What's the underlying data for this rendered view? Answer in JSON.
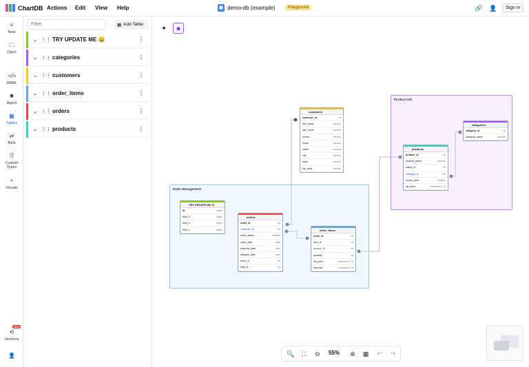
{
  "app": {
    "name": "ChartDB"
  },
  "menu": [
    "Actions",
    "Edit",
    "View",
    "Help"
  ],
  "database": {
    "name": "demo-db (example)",
    "badge": "Playground"
  },
  "header_right": {
    "signin": "Sign in"
  },
  "rail": {
    "items": [
      {
        "label": "New",
        "icon": "plus-icon"
      },
      {
        "label": "Open",
        "icon": "folder-icon"
      },
      {
        "label": "DBML",
        "icon": "code-icon"
      },
      {
        "label": "Agent",
        "icon": "agent-icon"
      },
      {
        "label": "Tables",
        "icon": "table-icon",
        "active": true
      },
      {
        "label": "Refs",
        "icon": "refs-icon"
      },
      {
        "label": "Custom Types",
        "icon": "file-icon"
      },
      {
        "label": "Visuals",
        "icon": "visuals-icon"
      }
    ],
    "bottom": [
      {
        "label": "Versions",
        "icon": "history-icon",
        "tag": "New"
      },
      {
        "label": "",
        "icon": "user-icon"
      }
    ]
  },
  "panel": {
    "filter_placeholder": "Filter",
    "add_table": "Add Table",
    "tables": [
      {
        "name": "TRY UPDATE ME 😀",
        "color": "#84cc16"
      },
      {
        "name": "categories",
        "color": "#a855f7"
      },
      {
        "name": "customers",
        "color": "#facc15"
      },
      {
        "name": "order_items",
        "color": "#60a5fa"
      },
      {
        "name": "orders",
        "color": "#ef4444"
      },
      {
        "name": "products",
        "color": "#2dd4bf"
      }
    ]
  },
  "areas": {
    "product": {
      "name": "Product Info"
    },
    "order": {
      "name": "Order Management"
    }
  },
  "diagram": {
    "customers": {
      "name": "customers",
      "color": "#facc15",
      "fields": [
        [
          "customer_id",
          "int",
          "pk"
        ],
        [
          "first_name",
          "varchar"
        ],
        [
          "last_name",
          "varchar"
        ],
        [
          "phone",
          "varchar"
        ],
        [
          "email",
          "varchar"
        ],
        [
          "street",
          "varchar"
        ],
        [
          "city",
          "varchar"
        ],
        [
          "state",
          "varchar"
        ],
        [
          "zip_code",
          "varchar"
        ]
      ]
    },
    "categories": {
      "name": "categories",
      "color": "#a855f7",
      "fields": [
        [
          "category_id",
          "int",
          "pk"
        ],
        [
          "category_name",
          "varchar"
        ]
      ]
    },
    "products": {
      "name": "products",
      "color": "#2dd4bf",
      "fields": [
        [
          "product_id",
          "int",
          "pk"
        ],
        [
          "product_name",
          "varchar"
        ],
        [
          "brand_id",
          "int"
        ],
        [
          "category_id",
          "int",
          "fk"
        ],
        [
          "model_year",
          "smallint"
        ],
        [
          "list_price",
          "numeric(10, 2)"
        ]
      ]
    },
    "tryupdate": {
      "name": "TRY UPDATE ME 😀",
      "color": "#84cc16",
      "fields": [
        [
          "id",
          "bigint",
          "pk"
        ],
        [
          "field_2",
          "bigint"
        ],
        [
          "field_3",
          "bigint"
        ],
        [
          "field_4",
          "bigint"
        ]
      ]
    },
    "orders": {
      "name": "orders",
      "color": "#ef4444",
      "fields": [
        [
          "order_id",
          "int",
          "pk"
        ],
        [
          "customer_id",
          "int",
          "fk"
        ],
        [
          "order_status",
          "smallint"
        ],
        [
          "order_date",
          "date"
        ],
        [
          "required_date",
          "date"
        ],
        [
          "shipped_date",
          "date"
        ],
        [
          "store_id",
          "int"
        ],
        [
          "staff_id",
          "int"
        ]
      ]
    },
    "order_items": {
      "name": "order_items",
      "color": "#60a5fa",
      "fields": [
        [
          "order_id",
          "int",
          "pk"
        ],
        [
          "item_id",
          "int"
        ],
        [
          "product_id",
          "int",
          "fk"
        ],
        [
          "quantity",
          "int"
        ],
        [
          "list_price",
          "numeric(10, 2)"
        ],
        [
          "discount",
          "numeric(4, 2)"
        ]
      ]
    }
  },
  "toolbar": {
    "zoom": "55%"
  }
}
